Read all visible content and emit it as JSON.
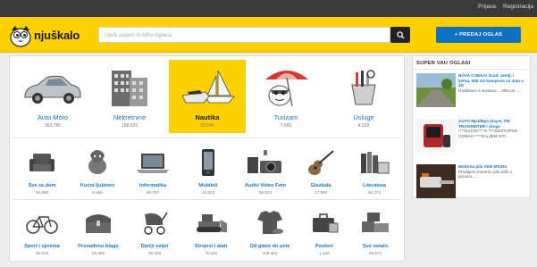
{
  "topbar": {
    "login": "Prijava",
    "register": "Registracija"
  },
  "header": {
    "logo_text": "njuškalo",
    "search_placeholder": "Upiši pojam ili šifru oglasa",
    "post_ad_label": "+ PREDAJ OGLAS"
  },
  "big_categories": [
    {
      "label": "Auto Moto",
      "count": "363.785",
      "icon": "car-icon"
    },
    {
      "label": "Nekretnine",
      "count": "168.503",
      "icon": "building-icon"
    },
    {
      "label": "Nautika",
      "count": "18.945",
      "icon": "boat-icon",
      "active": true
    },
    {
      "label": "Turizam",
      "count": "7.680",
      "icon": "beach-icon"
    },
    {
      "label": "Usluge",
      "count": "4.339",
      "icon": "tools-icon"
    }
  ],
  "small_categories_row1": [
    {
      "label": "Sve za dom",
      "count": "94.898",
      "icon": "armchair-icon"
    },
    {
      "label": "Kućni ljubimci",
      "count": "8.488",
      "icon": "pets-icon"
    },
    {
      "label": "Informatika",
      "count": "80.797",
      "icon": "laptop-icon"
    },
    {
      "label": "Mobiteli",
      "count": "40.823",
      "icon": "phone-icon"
    },
    {
      "label": "Audio Video Foto",
      "count": "56.603",
      "icon": "camera-icon"
    },
    {
      "label": "Glazbala",
      "count": "17.956",
      "icon": "guitar-icon"
    },
    {
      "label": "Literatura",
      "count": "82.372",
      "icon": "books-icon"
    }
  ],
  "small_categories_row2": [
    {
      "label": "Sport i oprema",
      "count": "50.319",
      "icon": "bicycle-icon"
    },
    {
      "label": "Pronađeno blago",
      "count": "55.369",
      "icon": "treasure-chest-icon"
    },
    {
      "label": "Dječji svijet",
      "count": "38.029",
      "icon": "stroller-icon"
    },
    {
      "label": "Strojevi i alati",
      "count": "75.640",
      "icon": "bulldozer-icon"
    },
    {
      "label": "Od glave do pete",
      "count": "109.464",
      "icon": "clothes-icon"
    },
    {
      "label": "Poslovi",
      "count": "1.436",
      "icon": "briefcase-icon"
    },
    {
      "label": "Sve ostalo",
      "count": "29.673",
      "icon": "boxes-icon"
    }
  ],
  "sidebar": {
    "title": "SUPER VAU OGLASI",
    "ads": [
      {
        "title": "NOVA CIJENA! Građ. zemlj. i ljetna, 545 m2 kampirno za stan u ZG",
        "sub": "Grašinovo s vezama ... 405 m2 ..."
      },
      {
        "title": "AUTO Mp3/Mp4 player, FM TRANSMITER i drugo",
        "sub": "****NAČIN****!!!  *** DOSTUPNO ODMAH ****ŠALJEM ISTI..."
      },
      {
        "title": "Motorna pila Stihl MS261",
        "sub": "Prodajem motornu pilu Stihl u ponovo..."
      }
    ]
  },
  "colors": {
    "brand_yellow": "#ffd000",
    "link_blue": "#1a74c6",
    "button_blue": "#0d71c4"
  }
}
